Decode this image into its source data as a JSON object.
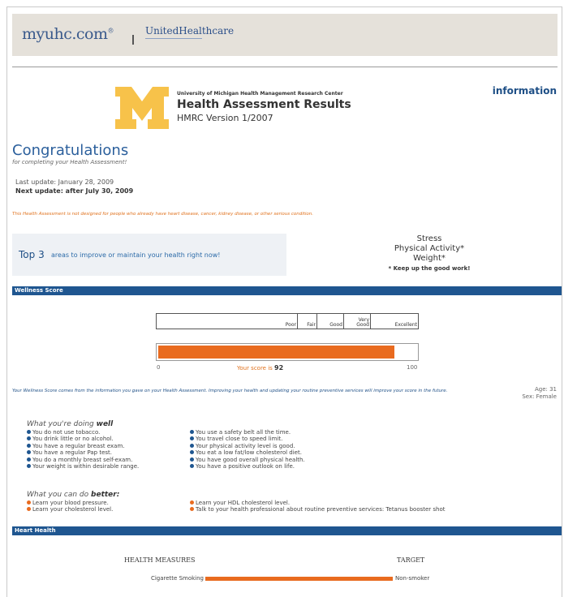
{
  "header": {
    "brand": "myuhc.com",
    "brand_mark": "®",
    "partner": "UnitedHealthcare"
  },
  "title_block": {
    "university": "University of Michigan Health Management Research Center",
    "title": "Health Assessment Results",
    "version": "HMRC Version 1/2007",
    "info_link": "information",
    "logo_letter": "M",
    "logo_color": "#f7c24a"
  },
  "congrats": {
    "heading": "Congratulations",
    "subheading": "for completing your Health Assessment!",
    "last_update": "Last update: January 28, 2009",
    "next_update": "Next update: after July 30, 2009",
    "disclaimer": "This Health Assessment is not designed for people who already have heart disease, cancer, kidney disease, or other serious condition."
  },
  "top3": {
    "label_bold": "Top 3",
    "label_rest": "areas to improve or maintain your health right now!",
    "areas": [
      "Stress",
      "Physical Activity*",
      "Weight*"
    ],
    "note": "* Keep up the good work!"
  },
  "wellness": {
    "section": "Wellness Score",
    "scale_labels": [
      "Poor",
      "Fair",
      "Good",
      "Very Good",
      "Excellent"
    ],
    "score_label": "Your score is",
    "score": 92,
    "score_max": 100,
    "min_label": "0",
    "max_label": "100",
    "explanation": "Your Wellness Score comes from the information you gave on your Health Assessment. Improving your health and updating your routine preventive services will improve your score in the future.",
    "age": "Age: 31",
    "sex": "Sex: Female",
    "accent": "#e96b1f"
  },
  "doing_well": {
    "heading_pre": "What you're doing",
    "heading_bold": "well",
    "left": [
      "You do not use tobacco.",
      "You drink little or no alcohol.",
      "You have a regular breast exam.",
      "You have a regular Pap test.",
      "You do a monthly breast self-exam.",
      "Your weight is within desirable range."
    ],
    "right": [
      "You use a safety belt all the time.",
      "You travel close to speed limit.",
      "Your physical activity level is good.",
      "You eat a low fat/low cholesterol diet.",
      "You have good overall physical health.",
      "You have a positive outlook on life."
    ]
  },
  "do_better": {
    "heading_pre": "What you can do",
    "heading_bold": "better",
    "left": [
      "Learn your blood pressure.",
      "Learn your cholesterol level."
    ],
    "right": [
      "Learn your HDL cholesterol level.",
      "Talk to your health professional about routine preventive services: Tetanus booster shot"
    ]
  },
  "heart": {
    "section": "Heart Health",
    "measures_head": "HEALTH MEASURES",
    "target_head": "TARGET",
    "rows": [
      {
        "label": "Cigarette Smoking",
        "target": "Non-smoker"
      }
    ]
  }
}
